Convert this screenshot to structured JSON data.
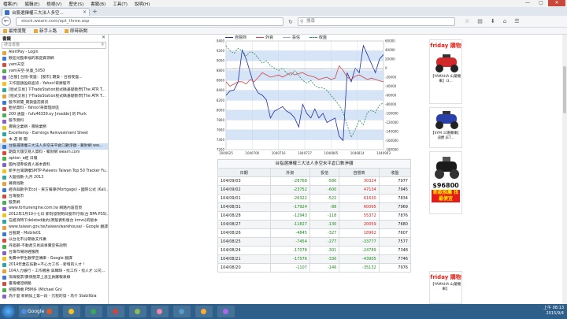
{
  "menu": [
    "檔案(F)",
    "編輯(E)",
    "檢視(V)",
    "歷史(S)",
    "書籤(B)",
    "工具(T)",
    "說明(H)"
  ],
  "tab": {
    "title": "台股選擇權三大法人多空..."
  },
  "url": "stock.wearn.com/opt_three.asp",
  "search_placeholder": "搜尋",
  "bookmarks_bar": [
    "最常瀏覽",
    "新手上路",
    "即時新聞"
  ],
  "sidebar": {
    "title": "書籤",
    "search_placeholder": "搜尋書籤",
    "items": [
      "AlertPay - Login",
      "歡迎光臨幸福的家庭資源網",
      "yam天空",
      "yam天空-兒童_5050",
      "[台股] 台指-夜盤：[股市] 期貨 - 台指夜盤...",
      "工作超額盈餘查詢 - Yahoo!奇摩股市",
      "[程式交易] 下TradeStation程式碼基礎教學[The ATR T...",
      "[程式交易] 下TradeStation程式碼基礎教學[The ATR T...",
      "股市新聞_期貨盤前資訊",
      "胎兒資料 - Yahoo!奇摩理財區",
      "200 通盤 - fufu46339.oy [madde] 的 Plurk",
      "股市資料",
      "壽險企業網 - 壽險業務",
      "Exceltemp - Earnings Reinvestment Sheet",
      "本 週 新 聞",
      "台股選擇權三大法人多空未平倉口數淨額 - 聚財網 ww...",
      "期貨大額交易人資料 - 聚財網 wearn.com",
      "option_e經 日報",
      "國內證券投資人基本資料",
      "新手台灣期權SMTP-Paleens Taiwan Top 50 Tracker Fu...",
      "大盤指數-九月 2013",
      "募資指數",
      "經濟與數字(Eco) - 東方報導(Mortgage)・國際公式 (Kali...",
      "台灣股市",
      "股票網",
      "www.fortunengine.com.tw 網路內容首頁",
      "2012年1月19十七日 即刻發現明日股市行情(台 BPA.PSS)...",
      "在經濟時下deleted後約(原股資料版台 kmvs)的版本",
      "www.taiwan.gov.tw/taiwan/warehouse/ - Google 翻譯",
      "台股期 - Mobile01",
      "以台北市分期收支作業",
      "丹鉅鋼-不動產交易與事實宣佈說明",
      "台灣市場財經服務",
      "免費中學生數學宣傳庫 - Google 翻譯",
      "2014年業在技數+不心力工作 - 新增的人才 !",
      "104人力銀行 - 工作機會 與職缺・找工作・找人才 公司...",
      "鴻海股票/賣保股票上漲五員屬報表線",
      "臺灣權證網路",
      "把握時機 PBM多 (Michael Gn)",
      "為什麼 新網加上第一段 - 元程的發・為什 Stabilibia"
    ]
  },
  "chart_data": {
    "type": "line",
    "title": "",
    "legend_position": "top",
    "y_left": {
      "ticks": [
        9400,
        9200,
        9000,
        8800,
        8600,
        8400,
        8200,
        8000,
        7800,
        7600,
        7400,
        7200
      ],
      "range": [
        7200,
        9400
      ]
    },
    "y_right": {
      "ticks": [
        60000,
        40000,
        20000,
        0,
        -20000,
        -40000,
        -60000,
        -80000,
        -100000,
        -120000,
        -140000,
        -160000,
        -180000
      ],
      "range": [
        -180000,
        60000
      ]
    },
    "x_ticks": [
      "1040625",
      "1040706",
      "1040716",
      "1040727",
      "1040805",
      "1040814",
      "1040903"
    ],
    "series": [
      {
        "name": "自營商",
        "color": "#1f2f9e",
        "axis": "right",
        "values": [
          -60000,
          -50000,
          -48000,
          -30000,
          40000,
          20000,
          -10000,
          -40000,
          -55000,
          -60000,
          -70000,
          -110000,
          -95000,
          -90000,
          -85000,
          -95000,
          -100000,
          -110000,
          -130000,
          -80000,
          -100000,
          -110000,
          -90000,
          -110000,
          -100000,
          -120000,
          -115000,
          -110000,
          -150000,
          -160000,
          -10000,
          -30000,
          0,
          -10000,
          50000,
          30000,
          10000,
          -10000,
          20000,
          30000
        ]
      },
      {
        "name": "外資",
        "color": "#d24444",
        "axis": "right",
        "values": [
          -30000,
          -40000,
          -35000,
          -30000,
          -30000,
          -35000,
          -25000,
          -30000,
          -20000,
          -10000,
          -15000,
          -20000,
          -18000,
          -15000,
          -20000,
          -15000,
          -10000,
          -15000,
          -12000,
          -10000,
          -15000,
          -18000,
          -20000,
          -25000,
          -22000,
          -20000,
          -25000,
          -22000,
          5000,
          -5000,
          -20000,
          -25000,
          -18000,
          -15000,
          -20000,
          -25000,
          -22000,
          -25000,
          -28000,
          -30000
        ]
      },
      {
        "name": "投信",
        "color": "#9aa8d4",
        "axis": "right",
        "values": [
          -2000,
          -2500,
          -1500,
          -1800,
          -2200,
          -2000,
          -1500,
          -1900,
          -2100,
          -1800,
          -2000,
          -1700,
          -1900,
          -2100,
          -2000,
          -1800,
          -2200,
          -2000,
          -1900,
          -2100,
          -2000,
          -1800,
          -2300,
          -2000,
          -2100,
          -1900,
          -2000,
          -2200,
          -2100,
          -2000,
          -1900,
          -2000,
          -2100,
          -2200,
          -2000,
          -1800,
          -2000,
          -2100,
          -1900,
          -2000
        ]
      },
      {
        "name": "收盤",
        "color": "#2a8a5a",
        "axis": "left",
        "dashed": true,
        "values": [
          9300,
          9200,
          9150,
          9250,
          9200,
          9100,
          9180,
          9150,
          9050,
          8950,
          9000,
          8900,
          8850,
          8800,
          8850,
          8750,
          8700,
          8800,
          8700,
          8600,
          8550,
          8600,
          8500,
          8450,
          8450,
          8400,
          8300,
          8200,
          8100,
          7950,
          7700,
          7450,
          7600,
          7800,
          7700,
          7950,
          8000,
          7950,
          8100,
          8150
        ]
      }
    ]
  },
  "table": {
    "title": "台指選擇權三大法人多空未平倉口數淨額",
    "headers": [
      "日期",
      "外資",
      "投信",
      "自營商",
      "收盤"
    ],
    "rows": [
      [
        "104/09/03",
        "-28768",
        "-580",
        "30324",
        "7977"
      ],
      [
        "104/09/02",
        "-23752",
        "-600",
        "47134",
        "7945"
      ],
      [
        "104/09/01",
        "-26322",
        "-522",
        "61630",
        "7834"
      ],
      [
        "104/08/31",
        "-17924",
        "-88",
        "60095",
        "7969"
      ],
      [
        "104/08/28",
        "-12943",
        "-118",
        "55372",
        "7876"
      ],
      [
        "104/08/27",
        "-11827",
        "-130",
        "20059",
        "7680"
      ],
      [
        "104/08/26",
        "-4845",
        "-327",
        "18962",
        "7607"
      ],
      [
        "104/08/25",
        "-7454",
        "-277",
        "-33777",
        "7577"
      ],
      [
        "104/08/24",
        "-17078",
        "-301",
        "-24789",
        "7348"
      ],
      [
        "104/08/21",
        "-17576",
        "-330",
        "-43905",
        "7746"
      ],
      [
        "104/08/20",
        "-1107",
        "-146",
        "-35132",
        "7976"
      ]
    ]
  },
  "ads": [
    {
      "brand": "friday 購物",
      "caption": "【YAMAHA 山葉機車】i3..."
    },
    {
      "brand": "",
      "caption": "【SYM 三陽機車】迪爵 JET..."
    },
    {
      "brand": "",
      "caption": "",
      "price": "$96800",
      "button": "新款推薦 找最便宜"
    },
    {
      "brand": "friday 購物",
      "caption": "【YAMAHA 山葉機車】"
    }
  ],
  "taskbar": {
    "apps": [
      "Google",
      "",
      "",
      "",
      "",
      "",
      "",
      "",
      "",
      ""
    ],
    "time": "上午 08:13",
    "date": "2015/9/4"
  }
}
